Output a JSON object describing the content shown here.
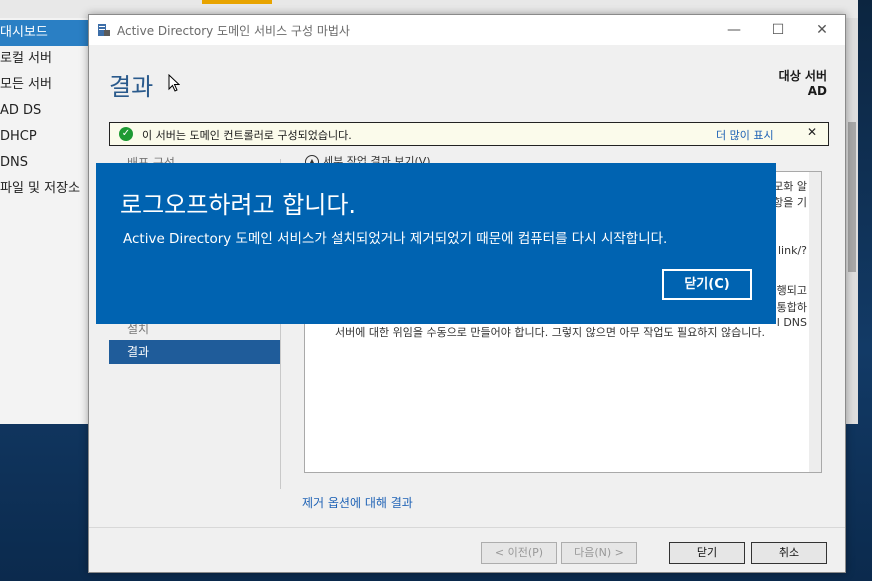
{
  "server_manager": {
    "sidebar": [
      {
        "label": "대시보드",
        "selected": true
      },
      {
        "label": "로컬 서버",
        "selected": false
      },
      {
        "label": "모든 서버",
        "selected": false
      },
      {
        "label": "AD DS",
        "selected": false
      },
      {
        "label": "DHCP",
        "selected": false
      },
      {
        "label": "DNS",
        "selected": false
      },
      {
        "label": "파일 및 저장소",
        "selected": false
      }
    ]
  },
  "wizard": {
    "title": "Active Directory 도메인 서비스 구성 마법사",
    "window_controls": {
      "minimize": "—",
      "maximize": "☐",
      "close": "✕"
    },
    "heading": "결과",
    "target_server_label": "대상 서버",
    "target_server_value": "AD",
    "notice": {
      "text": "이 서버는 도메인 컨트롤러로 구성되었습니다.",
      "more_link": "더 많이 표시",
      "close": "✕"
    },
    "nav": [
      {
        "label": "배포 구성",
        "active": false
      },
      {
        "label": "설치",
        "active": false
      },
      {
        "label": "결과",
        "active": true
      }
    ],
    "task_toggle": "세부 작업 결과 보기(V)",
    "content": {
      "right_fragments": [
        "모화 알",
        "항을 기",
        "link/?",
        "행되고",
        "통합하",
        "l DNS"
      ],
      "paragraph": "서버에 대한 위임을 수동으로 만들어야 합니다. 그렇지 않으면 아무 작업도 필요하지 않습니다."
    },
    "removal_link": "제거 옵션에 대해 결과",
    "buttons": {
      "prev": "< 이전(P)",
      "next": "다음(N) >",
      "close": "닫기",
      "cancel": "취소"
    }
  },
  "logoff_notice": {
    "title": "로그오프하려고 합니다.",
    "message": "Active Directory 도메인 서비스가 설치되었거나 제거되었기 때문에 컴퓨터를 다시 시작합니다.",
    "close_button": "닫기(C)",
    "background_color": "#0063b1"
  }
}
